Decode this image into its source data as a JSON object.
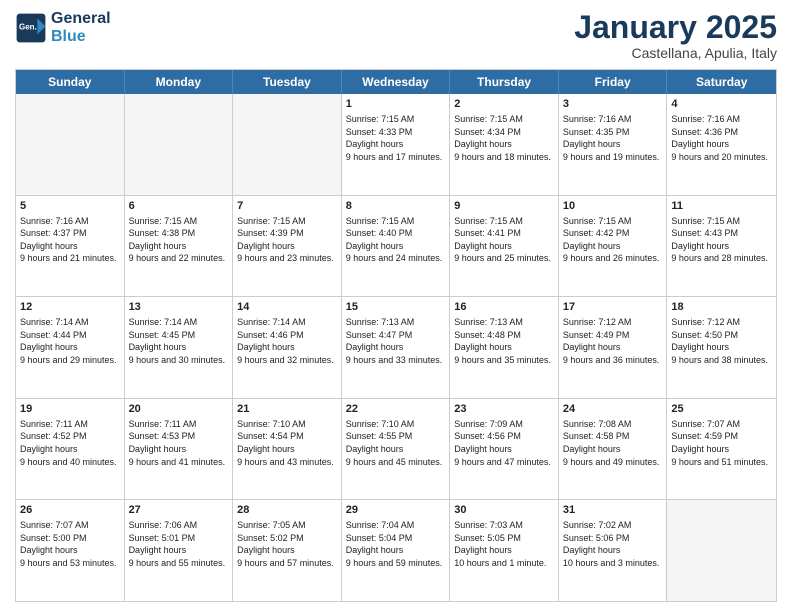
{
  "header": {
    "logo": {
      "line1": "General",
      "line2": "Blue"
    },
    "title": "January 2025",
    "location": "Castellana, Apulia, Italy"
  },
  "days_of_week": [
    "Sunday",
    "Monday",
    "Tuesday",
    "Wednesday",
    "Thursday",
    "Friday",
    "Saturday"
  ],
  "weeks": [
    [
      {
        "day": "",
        "empty": true
      },
      {
        "day": "",
        "empty": true
      },
      {
        "day": "",
        "empty": true
      },
      {
        "day": "1",
        "sunrise": "7:15 AM",
        "sunset": "4:33 PM",
        "daylight": "9 hours and 17 minutes."
      },
      {
        "day": "2",
        "sunrise": "7:15 AM",
        "sunset": "4:34 PM",
        "daylight": "9 hours and 18 minutes."
      },
      {
        "day": "3",
        "sunrise": "7:16 AM",
        "sunset": "4:35 PM",
        "daylight": "9 hours and 19 minutes."
      },
      {
        "day": "4",
        "sunrise": "7:16 AM",
        "sunset": "4:36 PM",
        "daylight": "9 hours and 20 minutes."
      }
    ],
    [
      {
        "day": "5",
        "sunrise": "7:16 AM",
        "sunset": "4:37 PM",
        "daylight": "9 hours and 21 minutes."
      },
      {
        "day": "6",
        "sunrise": "7:15 AM",
        "sunset": "4:38 PM",
        "daylight": "9 hours and 22 minutes."
      },
      {
        "day": "7",
        "sunrise": "7:15 AM",
        "sunset": "4:39 PM",
        "daylight": "9 hours and 23 minutes."
      },
      {
        "day": "8",
        "sunrise": "7:15 AM",
        "sunset": "4:40 PM",
        "daylight": "9 hours and 24 minutes."
      },
      {
        "day": "9",
        "sunrise": "7:15 AM",
        "sunset": "4:41 PM",
        "daylight": "9 hours and 25 minutes."
      },
      {
        "day": "10",
        "sunrise": "7:15 AM",
        "sunset": "4:42 PM",
        "daylight": "9 hours and 26 minutes."
      },
      {
        "day": "11",
        "sunrise": "7:15 AM",
        "sunset": "4:43 PM",
        "daylight": "9 hours and 28 minutes."
      }
    ],
    [
      {
        "day": "12",
        "sunrise": "7:14 AM",
        "sunset": "4:44 PM",
        "daylight": "9 hours and 29 minutes."
      },
      {
        "day": "13",
        "sunrise": "7:14 AM",
        "sunset": "4:45 PM",
        "daylight": "9 hours and 30 minutes."
      },
      {
        "day": "14",
        "sunrise": "7:14 AM",
        "sunset": "4:46 PM",
        "daylight": "9 hours and 32 minutes."
      },
      {
        "day": "15",
        "sunrise": "7:13 AM",
        "sunset": "4:47 PM",
        "daylight": "9 hours and 33 minutes."
      },
      {
        "day": "16",
        "sunrise": "7:13 AM",
        "sunset": "4:48 PM",
        "daylight": "9 hours and 35 minutes."
      },
      {
        "day": "17",
        "sunrise": "7:12 AM",
        "sunset": "4:49 PM",
        "daylight": "9 hours and 36 minutes."
      },
      {
        "day": "18",
        "sunrise": "7:12 AM",
        "sunset": "4:50 PM",
        "daylight": "9 hours and 38 minutes."
      }
    ],
    [
      {
        "day": "19",
        "sunrise": "7:11 AM",
        "sunset": "4:52 PM",
        "daylight": "9 hours and 40 minutes."
      },
      {
        "day": "20",
        "sunrise": "7:11 AM",
        "sunset": "4:53 PM",
        "daylight": "9 hours and 41 minutes."
      },
      {
        "day": "21",
        "sunrise": "7:10 AM",
        "sunset": "4:54 PM",
        "daylight": "9 hours and 43 minutes."
      },
      {
        "day": "22",
        "sunrise": "7:10 AM",
        "sunset": "4:55 PM",
        "daylight": "9 hours and 45 minutes."
      },
      {
        "day": "23",
        "sunrise": "7:09 AM",
        "sunset": "4:56 PM",
        "daylight": "9 hours and 47 minutes."
      },
      {
        "day": "24",
        "sunrise": "7:08 AM",
        "sunset": "4:58 PM",
        "daylight": "9 hours and 49 minutes."
      },
      {
        "day": "25",
        "sunrise": "7:07 AM",
        "sunset": "4:59 PM",
        "daylight": "9 hours and 51 minutes."
      }
    ],
    [
      {
        "day": "26",
        "sunrise": "7:07 AM",
        "sunset": "5:00 PM",
        "daylight": "9 hours and 53 minutes."
      },
      {
        "day": "27",
        "sunrise": "7:06 AM",
        "sunset": "5:01 PM",
        "daylight": "9 hours and 55 minutes."
      },
      {
        "day": "28",
        "sunrise": "7:05 AM",
        "sunset": "5:02 PM",
        "daylight": "9 hours and 57 minutes."
      },
      {
        "day": "29",
        "sunrise": "7:04 AM",
        "sunset": "5:04 PM",
        "daylight": "9 hours and 59 minutes."
      },
      {
        "day": "30",
        "sunrise": "7:03 AM",
        "sunset": "5:05 PM",
        "daylight": "10 hours and 1 minute."
      },
      {
        "day": "31",
        "sunrise": "7:02 AM",
        "sunset": "5:06 PM",
        "daylight": "10 hours and 3 minutes."
      },
      {
        "day": "",
        "empty": true
      }
    ]
  ]
}
